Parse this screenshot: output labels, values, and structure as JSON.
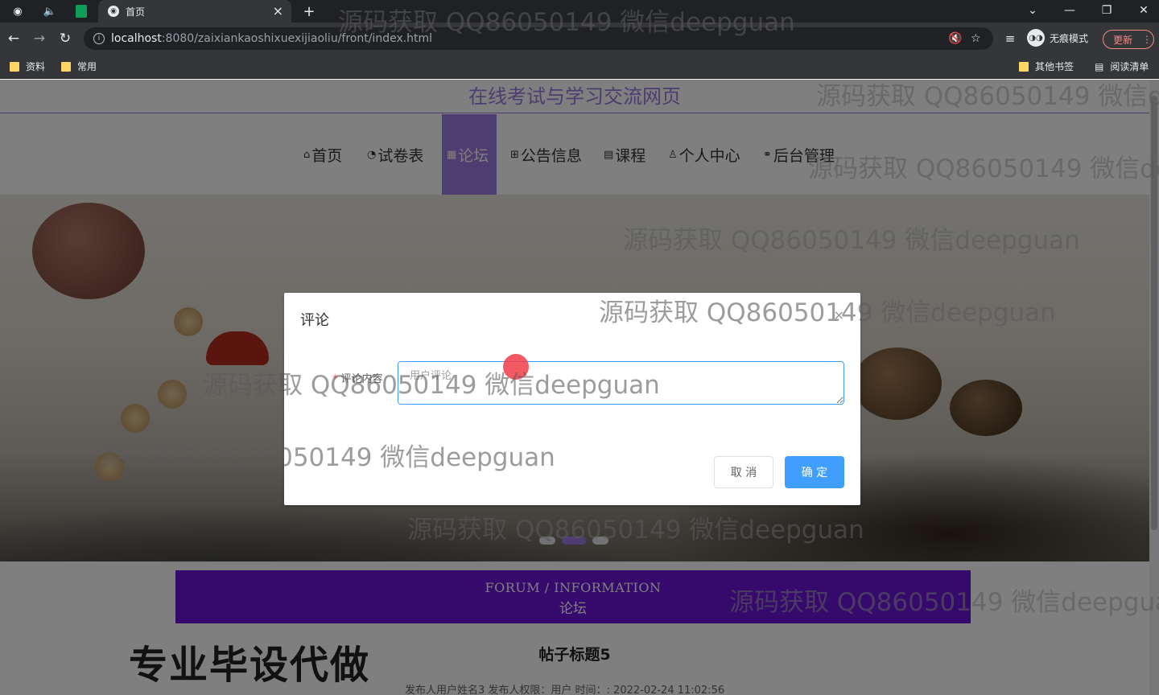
{
  "browser": {
    "tab_title": "首页",
    "new_tab": "+",
    "url_host": "localhost",
    "url_path": ":8080/zaixiankaoshixuexijiaoliu/front/index.html",
    "incognito_label": "无痕模式",
    "update_label": "更新",
    "bookmarks": [
      "资料",
      "常用"
    ],
    "other_bookmarks": "其他书签",
    "reading_list": "阅读清单"
  },
  "site": {
    "title": "在线考试与学习交流网页",
    "nav": [
      {
        "label": "首页",
        "icon": "home-icon",
        "glyph": "⌂"
      },
      {
        "label": "试卷表",
        "icon": "dashboard-icon",
        "glyph": "◔"
      },
      {
        "label": "论坛",
        "icon": "forum-icon",
        "glyph": "▦",
        "active": true
      },
      {
        "label": "公告信息",
        "icon": "notice-icon",
        "glyph": "⊞"
      },
      {
        "label": "课程",
        "icon": "course-icon",
        "glyph": "▤"
      },
      {
        "label": "个人中心",
        "icon": "user-icon",
        "glyph": "♙"
      },
      {
        "label": "后台管理",
        "icon": "link-icon",
        "glyph": "⚭"
      }
    ]
  },
  "forum": {
    "header_en": "FORUM / INFORMATION",
    "header_cn": "论坛",
    "post_title": "帖子标题5",
    "post_meta": "发布人用户姓名3   发布人权限：用户   时间：: 2022-02-24 11:02:56"
  },
  "promo_text": "专业毕设代做",
  "dialog": {
    "title": "评论",
    "close": "×",
    "field_label": "评论内容",
    "field_placeholder": "用户评论",
    "cancel": "取 消",
    "ok": "确 定"
  },
  "watermark": "源码获取 QQ86050149 微信deepguan"
}
